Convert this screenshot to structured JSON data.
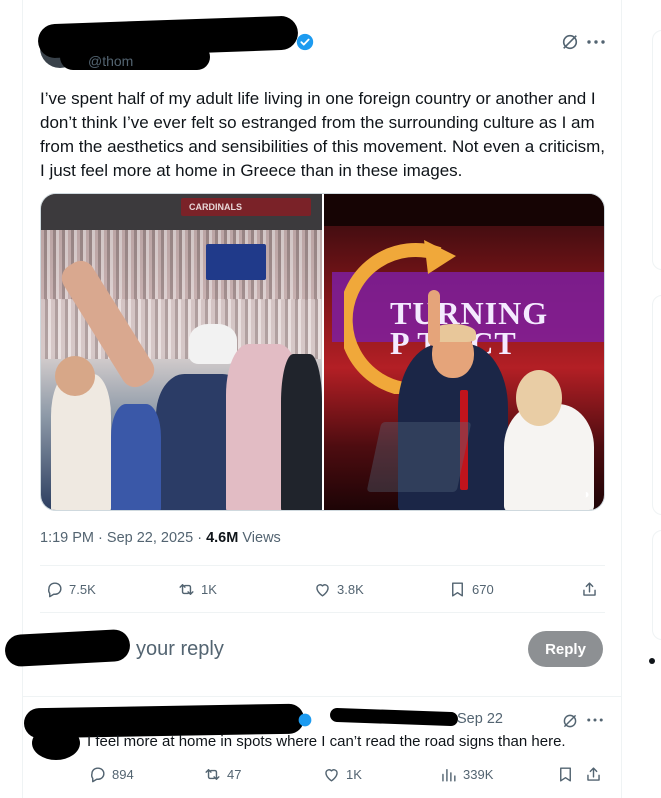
{
  "tweet": {
    "handle": "@thom",
    "text": "I’ve spent half of my adult life living in one foreign country or another and I don’t think I’ve ever felt so estranged from the surrounding culture as I am from the aesthetics and sensibilities of this movement. Not even a criticism, I just feel more at home in Greece than in these images.",
    "media": {
      "left_sign": "CARDINALS",
      "right_sign_line1": "TURNING",
      "right_sign_line2": "P  T ACT"
    },
    "time": "1:19 PM",
    "date": "Sep 22, 2025",
    "views_count": "4.6M",
    "views_label": "Views",
    "separator": "·",
    "stats": {
      "replies": "7.5K",
      "reposts": "1K",
      "likes": "3.8K",
      "bookmarks": "670"
    }
  },
  "composer": {
    "placeholder": "your reply",
    "button_label": "Reply"
  },
  "reply": {
    "date": "Sep 22",
    "text": "I feel more at home in spots where I can’t read the road signs than here.",
    "stats": {
      "replies": "894",
      "reposts": "47",
      "likes": "1K",
      "views": "339K"
    }
  },
  "colors": {
    "verified": "#1d9bf0",
    "secondary_text": "#536471",
    "reply_button": "#8d9093"
  },
  "icons": [
    "grok-icon",
    "more-icon",
    "reply-icon",
    "repost-icon",
    "like-icon",
    "bookmark-icon",
    "share-icon",
    "views-icon",
    "verified-badge-icon"
  ]
}
